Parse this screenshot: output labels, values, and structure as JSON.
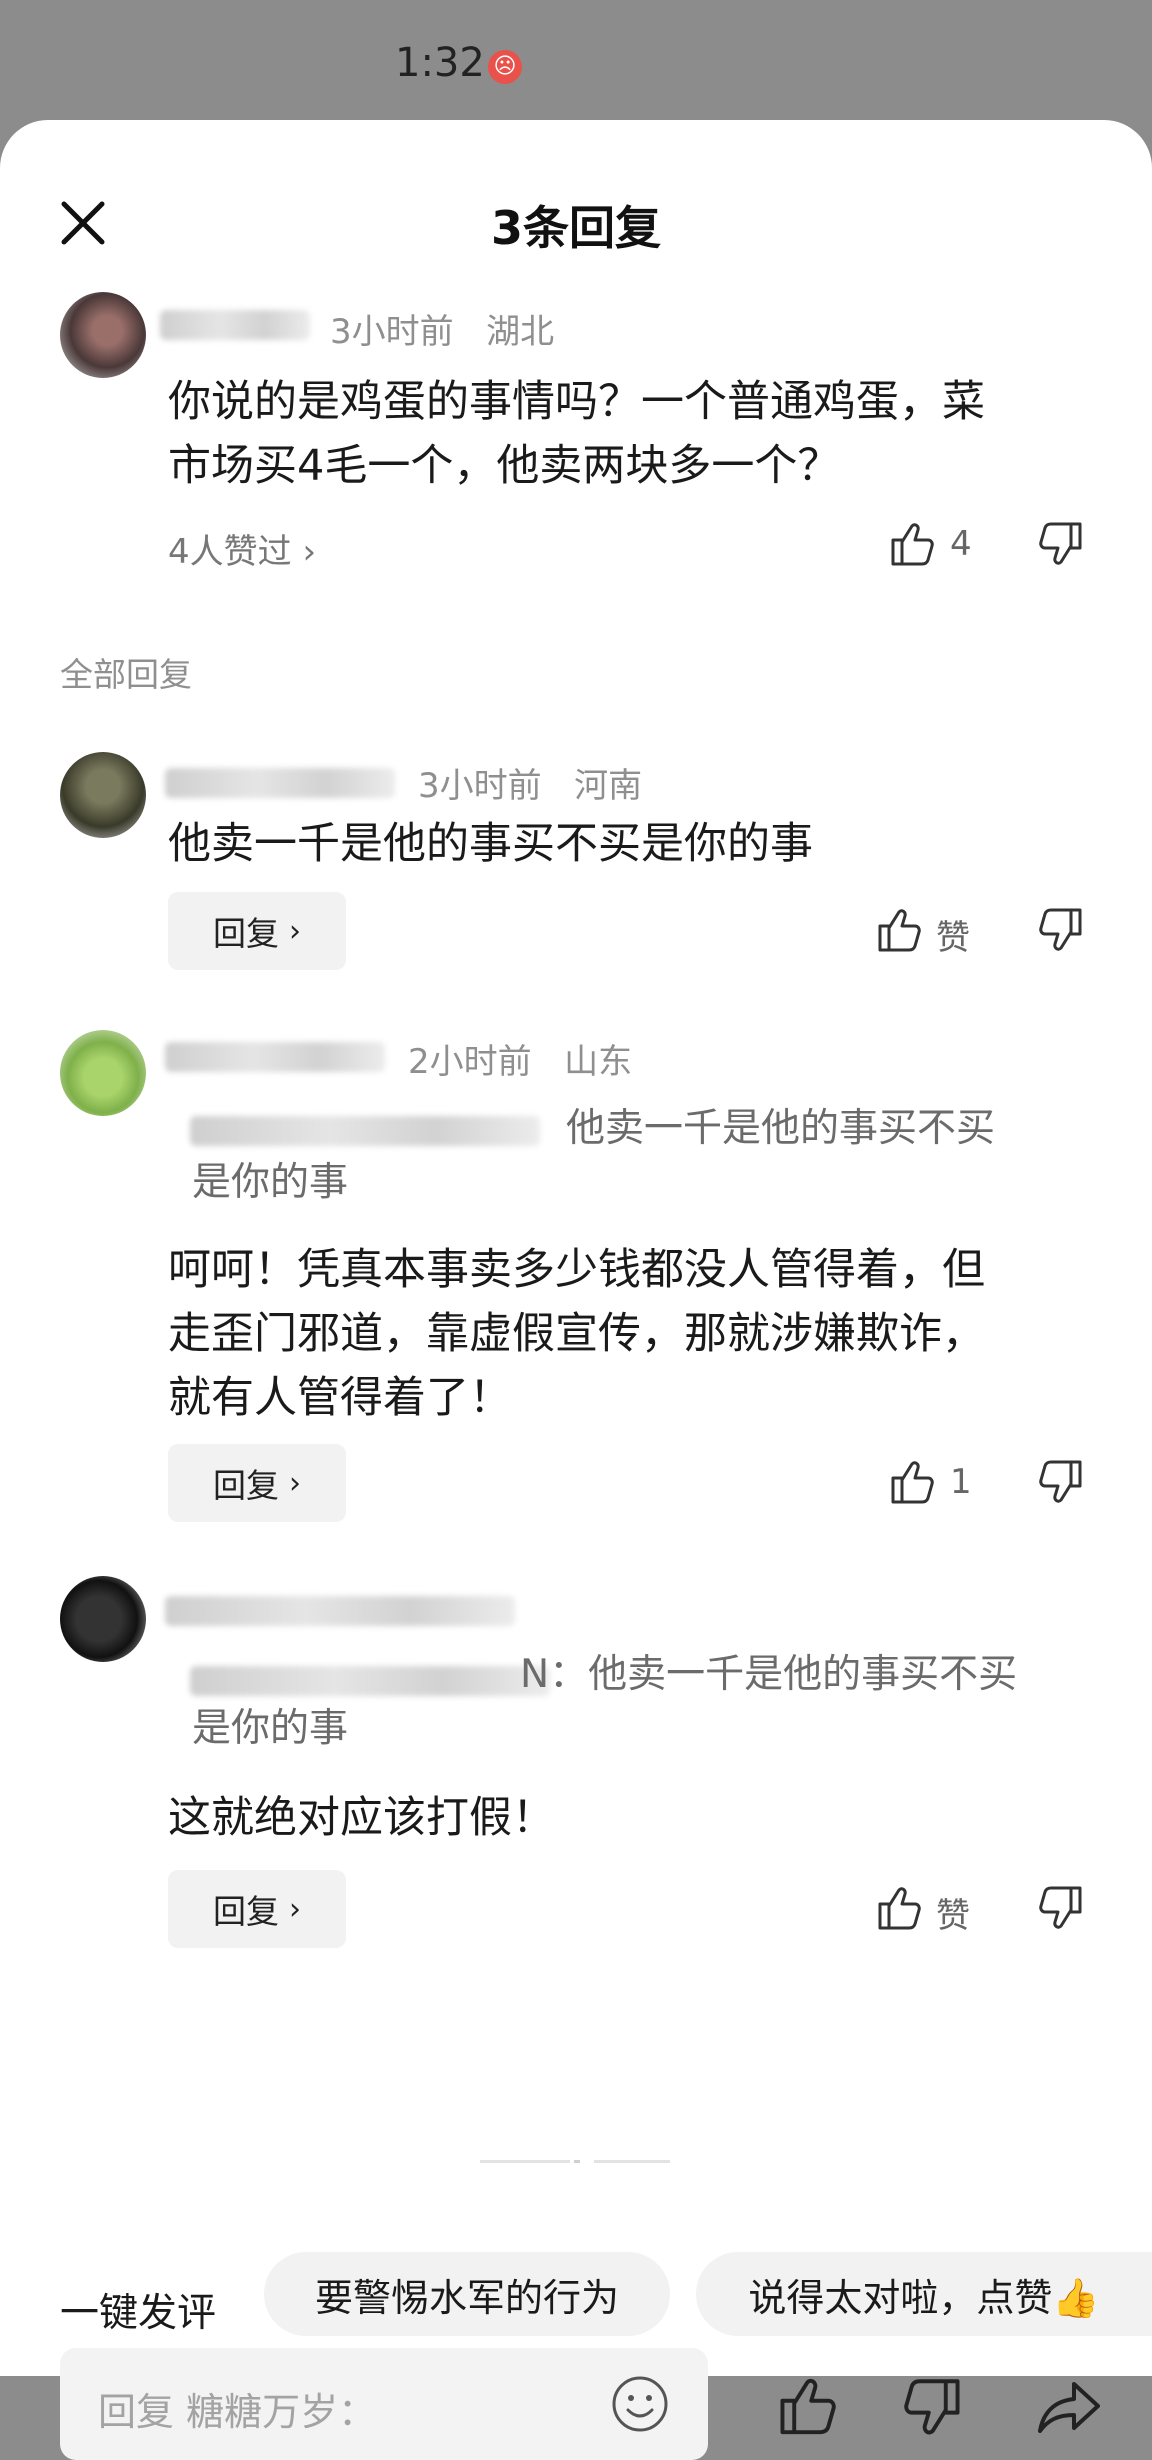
{
  "status_bar": {
    "time": "1:32",
    "badge": "☹"
  },
  "sheet": {
    "title": "3条回复"
  },
  "main_comment": {
    "time": "3小时前",
    "location": "湖北",
    "text_line1": "你说的是鸡蛋的事情吗？一个普通鸡蛋，菜",
    "text_line2": "市场买4毛一个，他卖两块多一个？",
    "likes_link": "4人赞过 ›",
    "like_count": "4"
  },
  "section_label": "全部回复",
  "replies": [
    {
      "time": "3小时前",
      "location": "河南",
      "text": "他卖一千是他的事买不买是你的事",
      "like_label": "赞"
    },
    {
      "time": "2小时前",
      "location": "山东",
      "quote_line1": "他卖一千是他的事买不买",
      "quote_line2": "是你的事",
      "text_line1": "呵呵！凭真本事卖多少钱都没人管得着，但",
      "text_line2": "走歪门邪道，靠虚假宣传，那就涉嫌欺诈，",
      "text_line3": "就有人管得着了！",
      "like_count": "1"
    },
    {
      "quote_line1": "N：他卖一千是他的事买不买",
      "quote_line2": "是你的事",
      "text": "这就绝对应该打假！",
      "like_label": "赞"
    }
  ],
  "reply_button_label": "回复",
  "reply_button_chevron": "›",
  "quick_comment": {
    "label": "一键发评",
    "chips": [
      "要警惕水军的行为",
      "说得太对啦，点赞👍"
    ]
  },
  "input": {
    "placeholder": "回复 糖糖万岁："
  },
  "icons": {
    "close": "close-icon",
    "thumb_up": "thumb-up-icon",
    "thumb_down": "thumb-down-icon",
    "emoji": "emoji-icon",
    "share": "share-icon"
  },
  "colors": {
    "sheet_bg": "#ffffff",
    "status_bg": "#8c8c8c",
    "chip_bg": "#f2f2f2",
    "meta_text": "#8f8f8f"
  }
}
